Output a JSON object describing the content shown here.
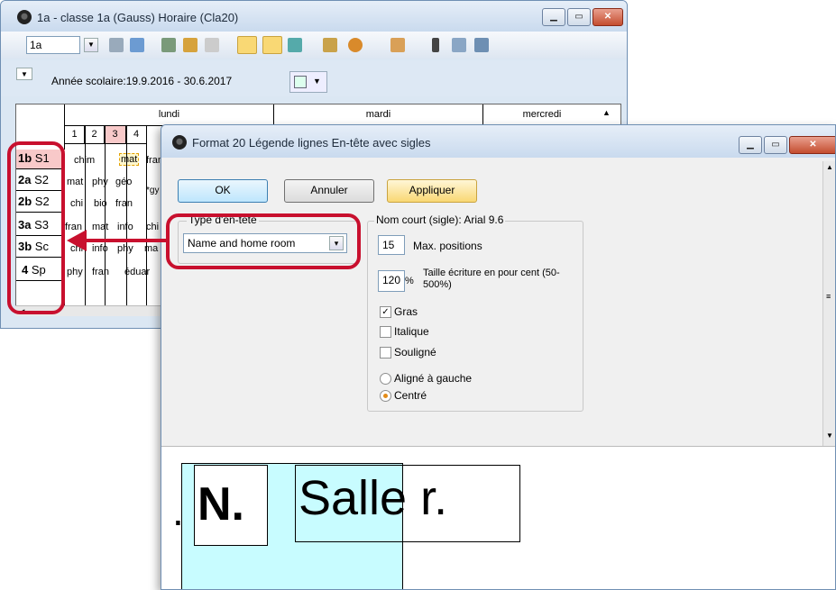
{
  "win1": {
    "title": "1a - classe 1a (Gauss)  Horaire  (Cla20)",
    "combo_value": "1a",
    "school_year": "Année scolaire:19.9.2016 - 30.6.2017",
    "days": [
      "lundi",
      "mardi",
      "mercredi"
    ],
    "periods": [
      "1",
      "2",
      "3",
      "4"
    ],
    "rows": [
      {
        "code": "1b",
        "room": "S1",
        "cells": [
          "chim",
          "mat",
          "fran"
        ]
      },
      {
        "code": "2a",
        "room": "S2",
        "cells": [
          "mat",
          "phy",
          "géo"
        ]
      },
      {
        "code": "2b",
        "room": "S2",
        "cells": [
          "chi",
          "bio",
          "fran"
        ]
      },
      {
        "code": "3a",
        "room": "S3",
        "cells": [
          "fran",
          "mat",
          "info",
          "chi"
        ]
      },
      {
        "code": "3b",
        "room": "Sc",
        "cells": [
          "chi",
          "info",
          "phy",
          "ma"
        ]
      },
      {
        "code": "4",
        "room": "Sp",
        "cells": [
          "phy",
          "fran",
          "éduar"
        ]
      }
    ],
    "gy_text": "*gy"
  },
  "win2": {
    "title": "Format 20  Légende lignes  En-tête avec sigles",
    "ok_label": "OK",
    "cancel_label": "Annuler",
    "apply_label": "Appliquer",
    "header_type_group": "Type d'en-tête",
    "header_type_value": "Name and home room",
    "short_name_group": "Nom court (sigle): Arial 9.6",
    "max_positions_value": "15",
    "max_positions_label": "Max. positions",
    "font_size_value": "120",
    "percent_sign": "%",
    "font_size_label": "Taille écriture en pour cent (50-500%)",
    "bold_label": "Gras",
    "italic_label": "Italique",
    "underline_label": "Souligné",
    "align_left_label": "Aligné à gauche",
    "centered_label": "Centré",
    "bold_checked": true,
    "centered_selected": true,
    "preview_dot": ".",
    "preview_n": "N.",
    "preview_salle": "Salle r."
  },
  "colors": {
    "annotation": "#c8102e",
    "accent_hot": "#f9d874",
    "preview_cyan": "#c8fcff"
  }
}
